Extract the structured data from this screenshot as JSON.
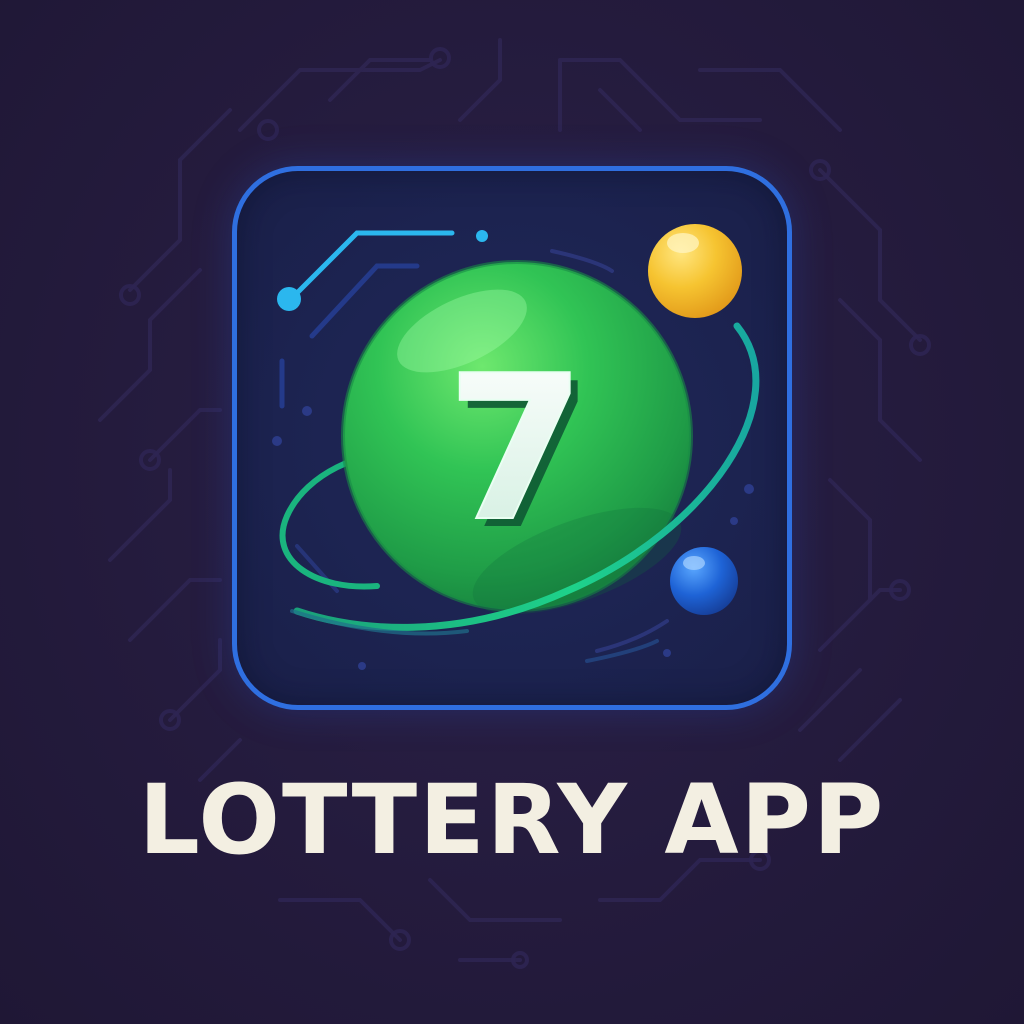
{
  "app": {
    "title": "LOTTERY APP",
    "ball_number": "7"
  },
  "icons": {
    "logo": "lottery-ball-logo-icon",
    "main_ball": "green-lottery-ball-icon",
    "yellow_ball": "yellow-ball-icon",
    "blue_ball": "blue-ball-icon",
    "orbit": "orbit-ring-icon"
  },
  "colors": {
    "background": "#22193a",
    "tile_border": "#2f6fe0",
    "tile_fill": "#1c2350",
    "ball_green": "#2fbf4f",
    "ball_yellow": "#f6c431",
    "ball_blue": "#1e63d6",
    "orbit": "#17c47a",
    "title_text": "#f3efe2"
  }
}
